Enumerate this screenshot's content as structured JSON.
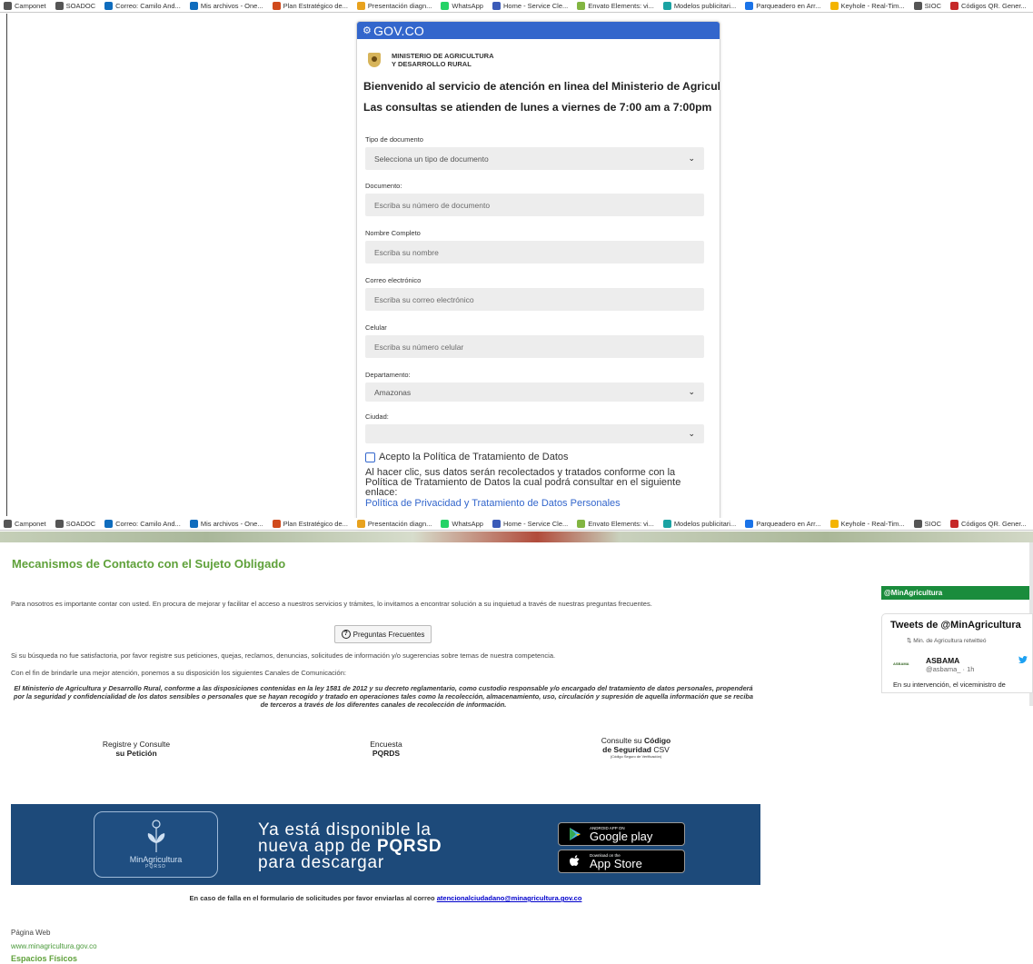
{
  "bookmarks_top": [
    {
      "label": "Camponet",
      "color": "#555555"
    },
    {
      "label": "SOADOC",
      "color": "#555555"
    },
    {
      "label": "Correo: Camilo And...",
      "color": "#0f6cbd"
    },
    {
      "label": "Mis archivos - One...",
      "color": "#0f6cbd"
    },
    {
      "label": "Plan Estratégico de...",
      "color": "#d04a1c"
    },
    {
      "label": "Presentación diagn...",
      "color": "#e8a21e"
    },
    {
      "label": "WhatsApp",
      "color": "#25d366"
    },
    {
      "label": "Home - Service Cle...",
      "color": "#3b5bb8"
    },
    {
      "label": "Envato Elements: vi...",
      "color": "#82b541"
    },
    {
      "label": "Modelos publicitari...",
      "color": "#1aa3a3"
    },
    {
      "label": "Parqueadero en Arr...",
      "color": "#1a73e8"
    },
    {
      "label": "Keyhole - Real-Tim...",
      "color": "#f4b400"
    },
    {
      "label": "SIOC",
      "color": "#555555"
    },
    {
      "label": "Códigos QR. Gener...",
      "color": "#c62828"
    }
  ],
  "bookmarks_bottom": [
    {
      "label": "Camponet",
      "color": "#555555"
    },
    {
      "label": "SOADOC",
      "color": "#555555"
    },
    {
      "label": "Correo: Camilo And...",
      "color": "#0f6cbd"
    },
    {
      "label": "Mis archivos - One...",
      "color": "#0f6cbd"
    },
    {
      "label": "Plan Estratégico de...",
      "color": "#d04a1c"
    },
    {
      "label": "Presentación diagn...",
      "color": "#e8a21e"
    },
    {
      "label": "WhatsApp",
      "color": "#25d366"
    },
    {
      "label": "Home - Service Cle...",
      "color": "#3b5bb8"
    },
    {
      "label": "Envato Elements: vi...",
      "color": "#82b541"
    },
    {
      "label": "Modelos publicitari...",
      "color": "#1aa3a3"
    },
    {
      "label": "Parqueadero en Arr...",
      "color": "#1a73e8"
    },
    {
      "label": "Keyhole - Real-Tim...",
      "color": "#f4b400"
    },
    {
      "label": "SIOC",
      "color": "#555555"
    },
    {
      "label": "Códigos QR. Gener...",
      "color": "#c62828"
    }
  ],
  "form": {
    "gov_brand": "GOV.CO",
    "ministry_line1": "MINISTERIO DE AGRICULTURA",
    "ministry_line2": "Y DESARROLLO RURAL",
    "welcome": "Bienvenido al servicio de atención en linea del Ministerio de Agricultura.",
    "schedule": "Las consultas se atienden de lunes a viernes de 7:00 am a 7:00pm",
    "doc_type_label": "Tipo de documento",
    "doc_type_value": "Selecciona un tipo de documento",
    "document_label": "Documento:",
    "document_placeholder": "Escriba su número de documento",
    "name_label": "Nombre Completo",
    "name_placeholder": "Escriba su nombre",
    "email_label": "Correo electrónico",
    "email_placeholder": "Escriba su correo electrónico",
    "phone_label": "Celular",
    "phone_placeholder": "Escriba su número celular",
    "department_label": "Departamento:",
    "department_value": "Amazonas",
    "city_label": "Ciudad:",
    "city_value": "",
    "consent_label": "Acepto la Política de Tratamiento de Datos",
    "consent_text": "Al hacer clic, sus datos serán recolectados y tratados conforme con la Política de Tratamiento de Datos la cual podrá consultar en el siguiente enlace:",
    "privacy_link": "Política de Privacidad y Tratamiento de Datos Personales",
    "brand_color": "#3366cc"
  },
  "contact": {
    "title": "Mecanismos de Contacto con el Sujeto Obligado",
    "intro": "Para nosotros es importante contar con usted. En procura de mejorar y facilitar el acceso a nuestros servicios y trámites, lo invitamos a encontrar solución a su inquietud a través de nuestras preguntas frecuentes.",
    "faq_button": "Preguntas Frecuentes",
    "search_text": "Si su búsqueda no fue satisfactoria, por favor registre sus peticiones, quejas, reclamos, denuncias, solicitudes de información y/o sugerencias sobre temas de nuestra competencia.",
    "channels_intro": "Con el fin de brindarle una mejor atención, ponemos a su disposición los siguientes Canales de Comunicación:",
    "disclaimer": "El Ministerio de Agricultura y Desarrollo Rural, conforme a las disposiciones contenidas en la ley 1581 de 2012 y su decreto reglamentario, como custodio responsable y/o encargado del tratamiento de datos personales, propenderá por la seguridad y confidencialidad de los datos sensibles o personales que se hayan recogido y tratado en operaciones tales como la recolección, almacenamiento, uso, circulación y supresión de aquella información que se reciba de terceros a través de los diferentes canales de recolección de información.",
    "channel1_line1": "Registre y Consulte",
    "channel1_line2": "su Petición",
    "channel2_line1": "Encuesta",
    "channel2_line2": "PQRDS",
    "channel3_line1": "Consulte su",
    "channel3_bold1": "Código",
    "channel3_bold2": "de Seguridad",
    "channel3_csv": "CSV",
    "channel3_small": "(Código Seguro de Verificación)",
    "accent_color": "#5fa13a"
  },
  "app_banner": {
    "logo_name": "MinAgricultura",
    "logo_sub": "PQRSD",
    "headline1": "Ya está disponible la",
    "headline2a": "nueva app de ",
    "headline2b": "PQRSD",
    "headline3": "para descargar",
    "gplay_small": "ANDROID APP ON",
    "gplay_big": "Google play",
    "appstore_small": "Download on the",
    "appstore_big": "App Store"
  },
  "footer": {
    "fallback_text": "En caso de falla en el formulario de solicitudes por favor enviarlas al correo ",
    "fallback_email": "atencionalciudadano@minagricultura.gov.co",
    "web_label": "Página Web",
    "web_link": "www.minagricultura.gov.co",
    "spaces": "Espacios Físicos"
  },
  "twitter": {
    "handle_header": "@MinAgricultura",
    "tweets_title": "Tweets de @MinAgricultura",
    "retweet_note": "Min. de Agricultura retwitteó",
    "avatar_label": "ASBAMA",
    "user": "ASBAMA",
    "user_handle": "@asbama_ · 1h",
    "tweet_text": "En su intervención, el viceministro de"
  }
}
